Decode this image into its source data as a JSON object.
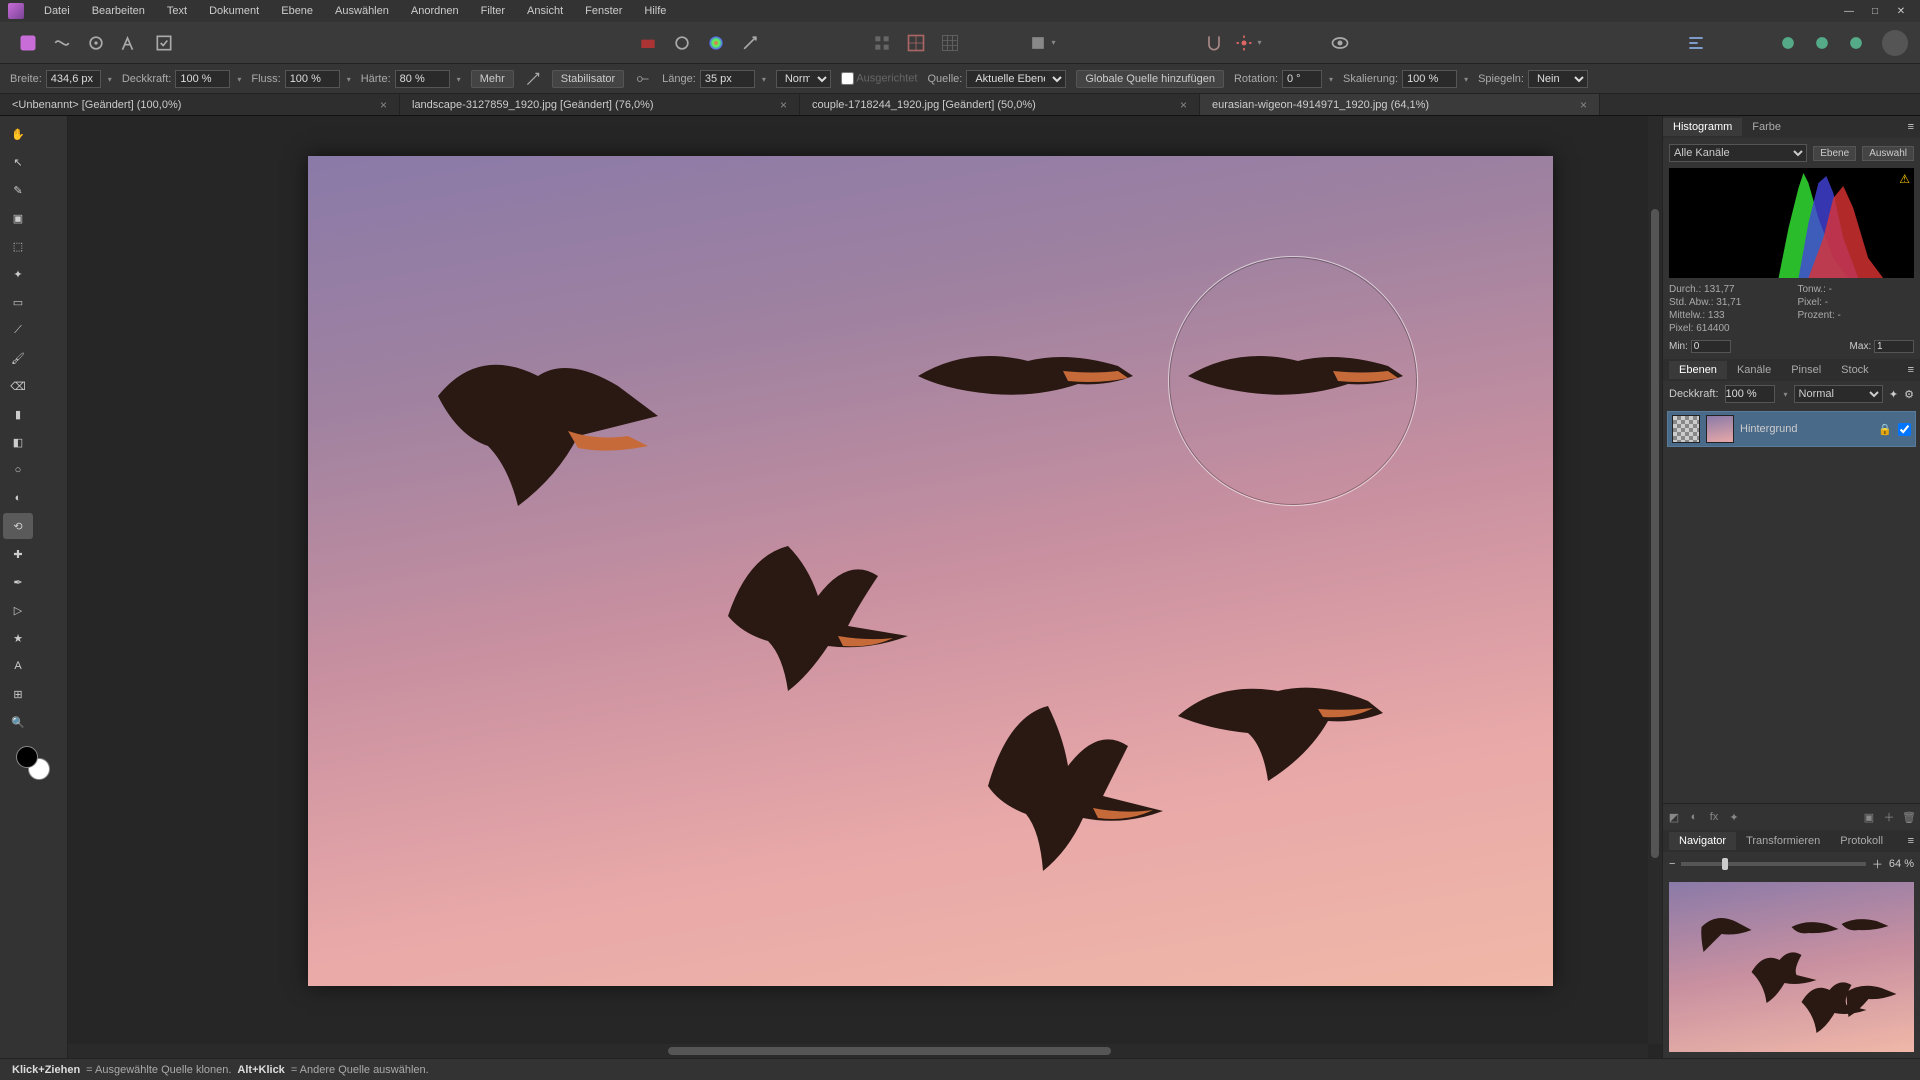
{
  "menu": [
    "Datei",
    "Bearbeiten",
    "Text",
    "Dokument",
    "Ebene",
    "Auswählen",
    "Anordnen",
    "Filter",
    "Ansicht",
    "Fenster",
    "Hilfe"
  ],
  "context": {
    "breite_label": "Breite:",
    "breite": "434,6 px",
    "deckkraft_label": "Deckkraft:",
    "deckkraft": "100 %",
    "fluss_label": "Fluss:",
    "fluss": "100 %",
    "haerte_label": "Härte:",
    "haerte": "80 %",
    "mehr": "Mehr",
    "stabilisator": "Stabilisator",
    "laenge_label": "Länge:",
    "laenge": "35 px",
    "mode": "Normal",
    "ausgerichtet": "Ausgerichtet",
    "quelle_label": "Quelle:",
    "quelle": "Aktuelle Ebene",
    "globale": "Globale Quelle hinzufügen",
    "rotation_label": "Rotation:",
    "rotation": "0 °",
    "skalierung_label": "Skalierung:",
    "skalierung": "100 %",
    "spiegeln_label": "Spiegeln:",
    "spiegeln": "Nein"
  },
  "tabs": [
    {
      "label": "<Unbenannt> [Geändert] (100,0%)",
      "active": false
    },
    {
      "label": "landscape-3127859_1920.jpg [Geändert] (76,0%)",
      "active": false
    },
    {
      "label": "couple-1718244_1920.jpg [Geändert] (50,0%)",
      "active": false
    },
    {
      "label": "eurasian-wigeon-4914971_1920.jpg (64,1%)",
      "active": true
    }
  ],
  "hist": {
    "tab_histogramm": "Histogramm",
    "tab_farbe": "Farbe",
    "channels": "Alle Kanäle",
    "ebene_btn": "Ebene",
    "auswahl_btn": "Auswahl",
    "durch": "Durch.: 131,77",
    "stdabw": "Std. Abw.: 31,71",
    "mittelw": "Mittelw.: 133",
    "pixel": "Pixel: 614400",
    "tonw": "Tonw.: -",
    "pixel2": "Pixel: -",
    "prozent": "Prozent: -",
    "min_label": "Min:",
    "min": "0",
    "max_label": "Max:",
    "max": "1"
  },
  "layers": {
    "tab_ebenen": "Ebenen",
    "tab_kanaele": "Kanäle",
    "tab_pinsel": "Pinsel",
    "tab_stock": "Stock",
    "deckkraft_label": "Deckkraft:",
    "deckkraft": "100 %",
    "blend": "Normal",
    "layer0": "Hintergrund"
  },
  "nav": {
    "tab_navigator": "Navigator",
    "tab_transformieren": "Transformieren",
    "tab_protokoll": "Protokoll",
    "zoom": "64 %"
  },
  "status": {
    "a_bold": "Klick+Ziehen",
    "a_rest": " = Ausgewählte Quelle klonen. ",
    "b_bold": "Alt+Klick",
    "b_rest": " = Andere Quelle auswählen."
  }
}
